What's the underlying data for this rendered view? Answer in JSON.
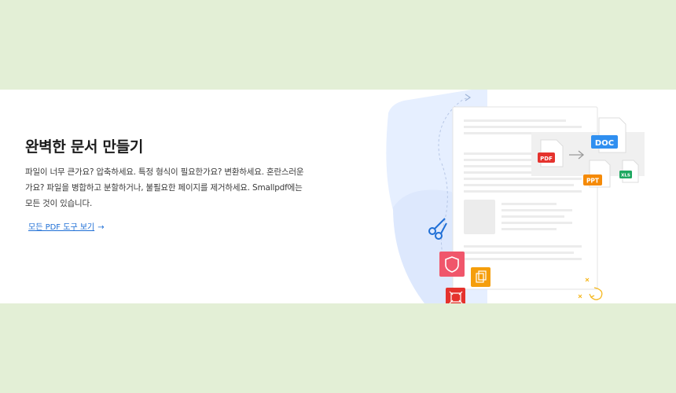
{
  "section": {
    "title": "완벽한 문서 만들기",
    "description": "파일이 너무 큰가요? 압축하세요. 특정 형식이 필요한가요? 변환하세요. 혼란스러운가요? 파일을 병합하고 분할하거나, 불필요한 페이지를 제거하세요. Smallpdf에는 모든 것이 있습니다.",
    "link_label": "모든 PDF 도구 보기",
    "link_arrow": "→"
  },
  "illustration": {
    "badges": {
      "doc": "DOC",
      "pdf": "PDF",
      "ppt": "PPT",
      "xls": "XLS"
    },
    "colors": {
      "doc": "#2f8ff0",
      "pdf": "#e5322d",
      "ppt": "#f58a07",
      "xls": "#1ea861",
      "shield_tile": "#f0566b",
      "copy_tile": "#f59e0b",
      "crop_tile": "#e5322d",
      "scissors": "#1f6fd6",
      "backdrop": "#e6efff"
    },
    "icons": [
      "scissors-icon",
      "shield-icon",
      "copy-icon",
      "crop-icon",
      "arrow-right-icon",
      "sparkle-icon"
    ]
  }
}
